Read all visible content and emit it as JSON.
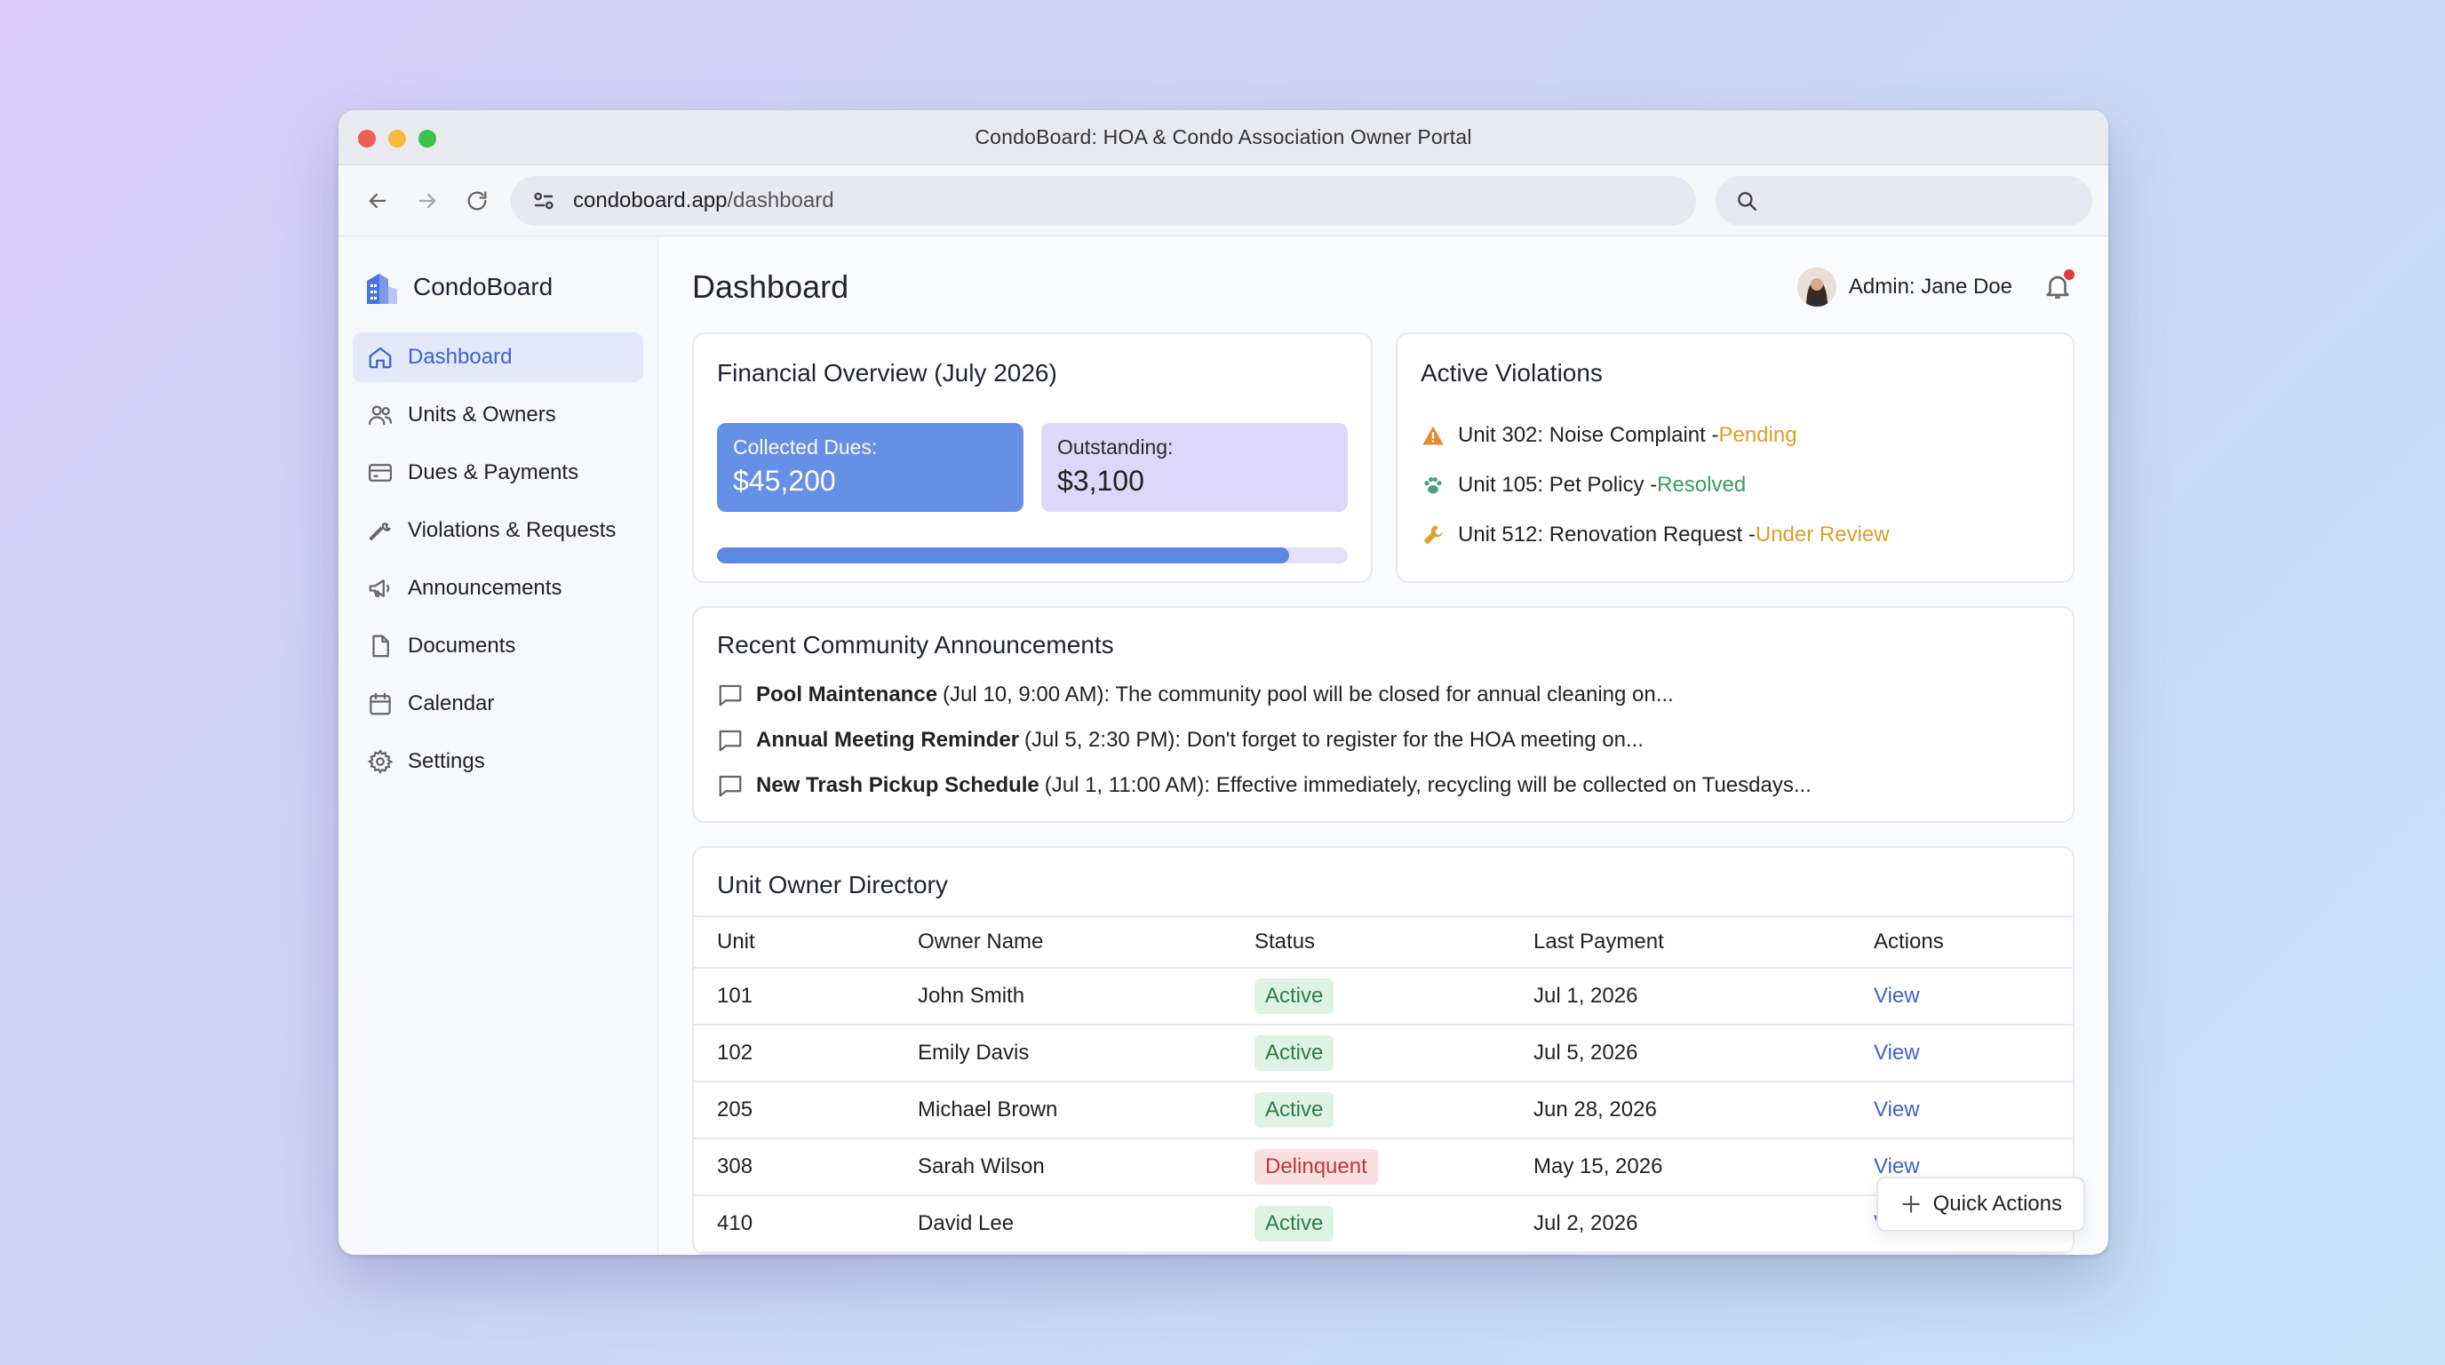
{
  "window": {
    "title": "CondoBoard: HOA & Condo Association Owner Portal"
  },
  "browser": {
    "url_domain": "condoboard.app",
    "url_path": "/dashboard",
    "search_placeholder": ""
  },
  "sidebar": {
    "brand": "CondoBoard",
    "items": [
      {
        "label": "Dashboard",
        "icon": "home-icon",
        "active": true
      },
      {
        "label": "Units & Owners",
        "icon": "users-icon"
      },
      {
        "label": "Dues & Payments",
        "icon": "credit-card-icon"
      },
      {
        "label": "Violations & Requests",
        "icon": "wrench-icon"
      },
      {
        "label": "Announcements",
        "icon": "megaphone-icon"
      },
      {
        "label": "Documents",
        "icon": "document-icon"
      },
      {
        "label": "Calendar",
        "icon": "calendar-icon"
      },
      {
        "label": "Settings",
        "icon": "gear-icon"
      }
    ]
  },
  "header": {
    "title": "Dashboard",
    "user": "Admin: Jane Doe"
  },
  "financial": {
    "title": "Financial Overview (July 2026)",
    "collected_label": "Collected Dues:",
    "collected_amount": "$45,200",
    "outstanding_label": "Outstanding:",
    "outstanding_amount": "$3,100",
    "progress_fraction": 0.907
  },
  "violations": {
    "title": "Active Violations",
    "items": [
      {
        "text": "Unit 302: Noise Complaint - ",
        "status": "Pending",
        "icon": "warning-icon",
        "color": "#e8892c"
      },
      {
        "text": "Unit 105: Pet Policy - ",
        "status": "Resolved",
        "icon": "paw-icon",
        "color": "#4f9e73"
      },
      {
        "text": "Unit 512: Renovation Request - ",
        "status": "Under Review",
        "icon": "wrench-icon",
        "color": "#e0a030"
      }
    ]
  },
  "announcements": {
    "title": "Recent Community Announcements",
    "items": [
      {
        "title": "Pool Maintenance",
        "rest": "(Jul 10, 9:00 AM): The community pool will be closed for annual cleaning on..."
      },
      {
        "title": "Annual Meeting Reminder",
        "rest": "(Jul 5, 2:30 PM): Don't forget to register for the HOA meeting on..."
      },
      {
        "title": "New Trash Pickup Schedule",
        "rest": "(Jul 1, 11:00 AM): Effective immediately, recycling will be collected on Tuesdays..."
      }
    ]
  },
  "directory": {
    "title": "Unit Owner Directory",
    "columns": [
      "Unit",
      "Owner Name",
      "Status",
      "Last Payment",
      "Actions"
    ],
    "rows": [
      {
        "unit": "101",
        "owner": "John Smith",
        "status": "Active",
        "last_payment": "Jul 1, 2026",
        "action": "View"
      },
      {
        "unit": "102",
        "owner": "Emily Davis",
        "status": "Active",
        "last_payment": "Jul 5, 2026",
        "action": "View"
      },
      {
        "unit": "205",
        "owner": "Michael Brown",
        "status": "Active",
        "last_payment": "Jun 28, 2026",
        "action": "View"
      },
      {
        "unit": "308",
        "owner": "Sarah Wilson",
        "status": "Delinquent",
        "last_payment": "May 15, 2026",
        "action": "View"
      },
      {
        "unit": "410",
        "owner": "David Lee",
        "status": "Active",
        "last_payment": "Jul 2, 2026",
        "action": "View"
      }
    ]
  },
  "quick_actions": {
    "label": "Quick Actions"
  },
  "colors": {
    "accent": "#3f64c7",
    "collected": "#6590e6",
    "outstanding": "#ddd7fa"
  }
}
